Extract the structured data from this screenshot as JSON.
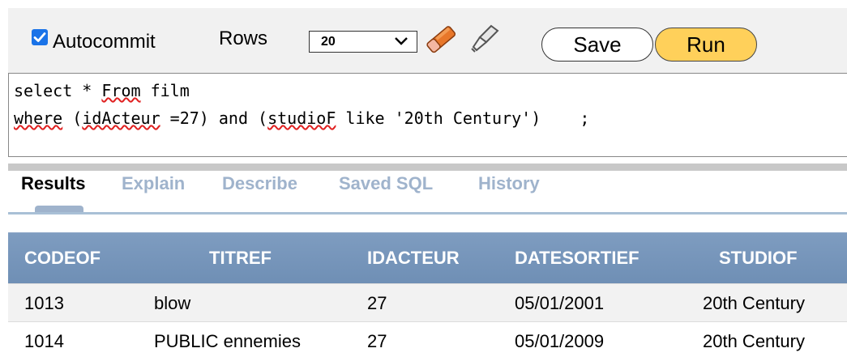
{
  "toolbar": {
    "autocommit_label": "Autocommit",
    "autocommit_checked": true,
    "rows_label": "Rows",
    "rows_value": "20",
    "save_label": "Save",
    "run_label": "Run",
    "clear_icon": "eraser-icon",
    "clean_icon": "broom-icon"
  },
  "editor": {
    "lines": [
      "select * From film",
      "where (idActeur =27) and (studioF like '20th Century')    ;"
    ]
  },
  "tabs": [
    {
      "label": "Results",
      "active": true
    },
    {
      "label": "Explain",
      "active": false
    },
    {
      "label": "Describe",
      "active": false
    },
    {
      "label": "Saved SQL",
      "active": false
    },
    {
      "label": "History",
      "active": false
    }
  ],
  "results": {
    "columns": [
      "CODEOF",
      "TITREF",
      "IDACTEUR",
      "DATESORTIEF",
      "STUDIOF"
    ],
    "rows": [
      [
        "1013",
        "blow",
        "27",
        "05/01/2001",
        "20th Century"
      ],
      [
        "1014",
        "PUBLIC ennemies",
        "27",
        "05/01/2009",
        "20th Century"
      ]
    ]
  },
  "colors": {
    "run_button": "#ffd05a",
    "header_bg": "#7495bc",
    "tab_inactive": "#9fb3cc",
    "checkbox": "#1a73e8"
  }
}
